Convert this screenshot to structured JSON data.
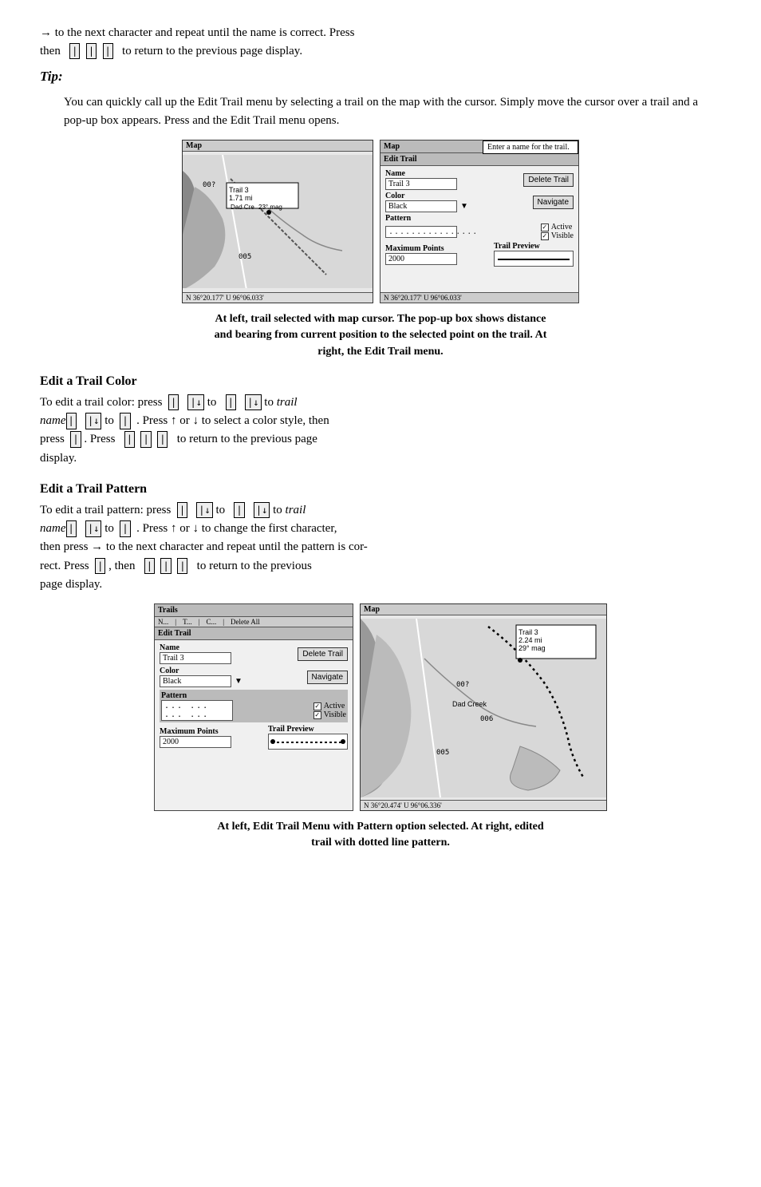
{
  "intro": {
    "line1": "→ to the next character and repeat until the name is correct. Press",
    "line2": "then",
    "line2_mid": "to return to the previous page display.",
    "tip_label": "Tip:",
    "tip_body": "You can quickly call up the Edit Trail menu by selecting a trail on the map with the cursor. Simply move the cursor over a trail and a pop-up box appears. Press        and the Edit Trail menu opens."
  },
  "caption1": {
    "text": "At left, trail selected with map cursor. The pop-up box shows distance\nand bearing from current position to the selected point on the trail. At\nright, the Edit Trail menu."
  },
  "section_color": {
    "heading": "Edit a Trail Color",
    "para1": "To edit a trail color: press        |↓ to        |↓ to trail\nname|    |↓ to    |  . Press ↑ or ↓ to select a color style, then\npress    . Press    |    |        to return to the previous page\ndisplay."
  },
  "section_pattern": {
    "heading": "Edit a Trail Pattern",
    "para1": "To edit a trail pattern: press        |↓ to        |↓ to trail\nname|    |↓ to    |  . Press ↑ or ↓ to change the first character,\nthen press → to the next character and repeat until the pattern is cor-\nrect. Press    , then    |    |        to return to the previous\npage display."
  },
  "caption2": {
    "text": "At left, Edit Trail Menu with Pattern option selected. At right, edited\ntrail with dotted line pattern."
  },
  "map1_left": {
    "label": "Map",
    "trail_name": "Trail 3",
    "trail_dist": "1.71 mi",
    "waypoint": "Dad Cre 23° mag",
    "waypoint_code": "00?",
    "status": "N  36°20.177'  U  96°06.033'"
  },
  "map1_right": {
    "label": "Map",
    "panel_header": "Edit Trail",
    "callout_text": "Enter a name for the trail.",
    "name_label": "Name",
    "name_value": "Trail 3",
    "delete_btn": "Delete Trail",
    "color_label": "Color",
    "color_value": "Black",
    "navigate_btn": "Navigate",
    "pattern_label": "Pattern",
    "pattern_value": "................",
    "active_label": "Active",
    "visible_label": "Visible",
    "maxpoints_label": "Maximum Points",
    "maxpoints_value": "2000",
    "trailpreview_label": "Trail Preview",
    "status": "N  36°20.177'  U  96°06.033'"
  },
  "panel2_left": {
    "header": "Trails",
    "subheader_items": [
      "N...",
      "T...",
      "|",
      "C...",
      "|",
      "Delete All"
    ],
    "edit_trail_label": "Edit Trail",
    "name_label": "Name",
    "name_value": "Trail 3",
    "delete_btn": "Delete Trail",
    "color_label": "Color",
    "color_value": "Black",
    "navigate_btn": "Navigate",
    "pattern_label": "Pattern",
    "pattern_value": "... ... ... ...",
    "active_label": "Active",
    "visible_label": "Visible",
    "maxpoints_label": "Maximum Points",
    "maxpoints_value": "2000",
    "trailpreview_label": "Trail Preview"
  },
  "map2_right": {
    "label": "Map",
    "trail_name": "Trail 3",
    "trail_dist": "2.24 mi",
    "trail_bearing": "29° mag",
    "waypoint_code": "00?",
    "dad_creek": "Dad Creek",
    "code006": "006",
    "code005": "005",
    "status": "N  36°20.474'  U  96°06.336'"
  }
}
